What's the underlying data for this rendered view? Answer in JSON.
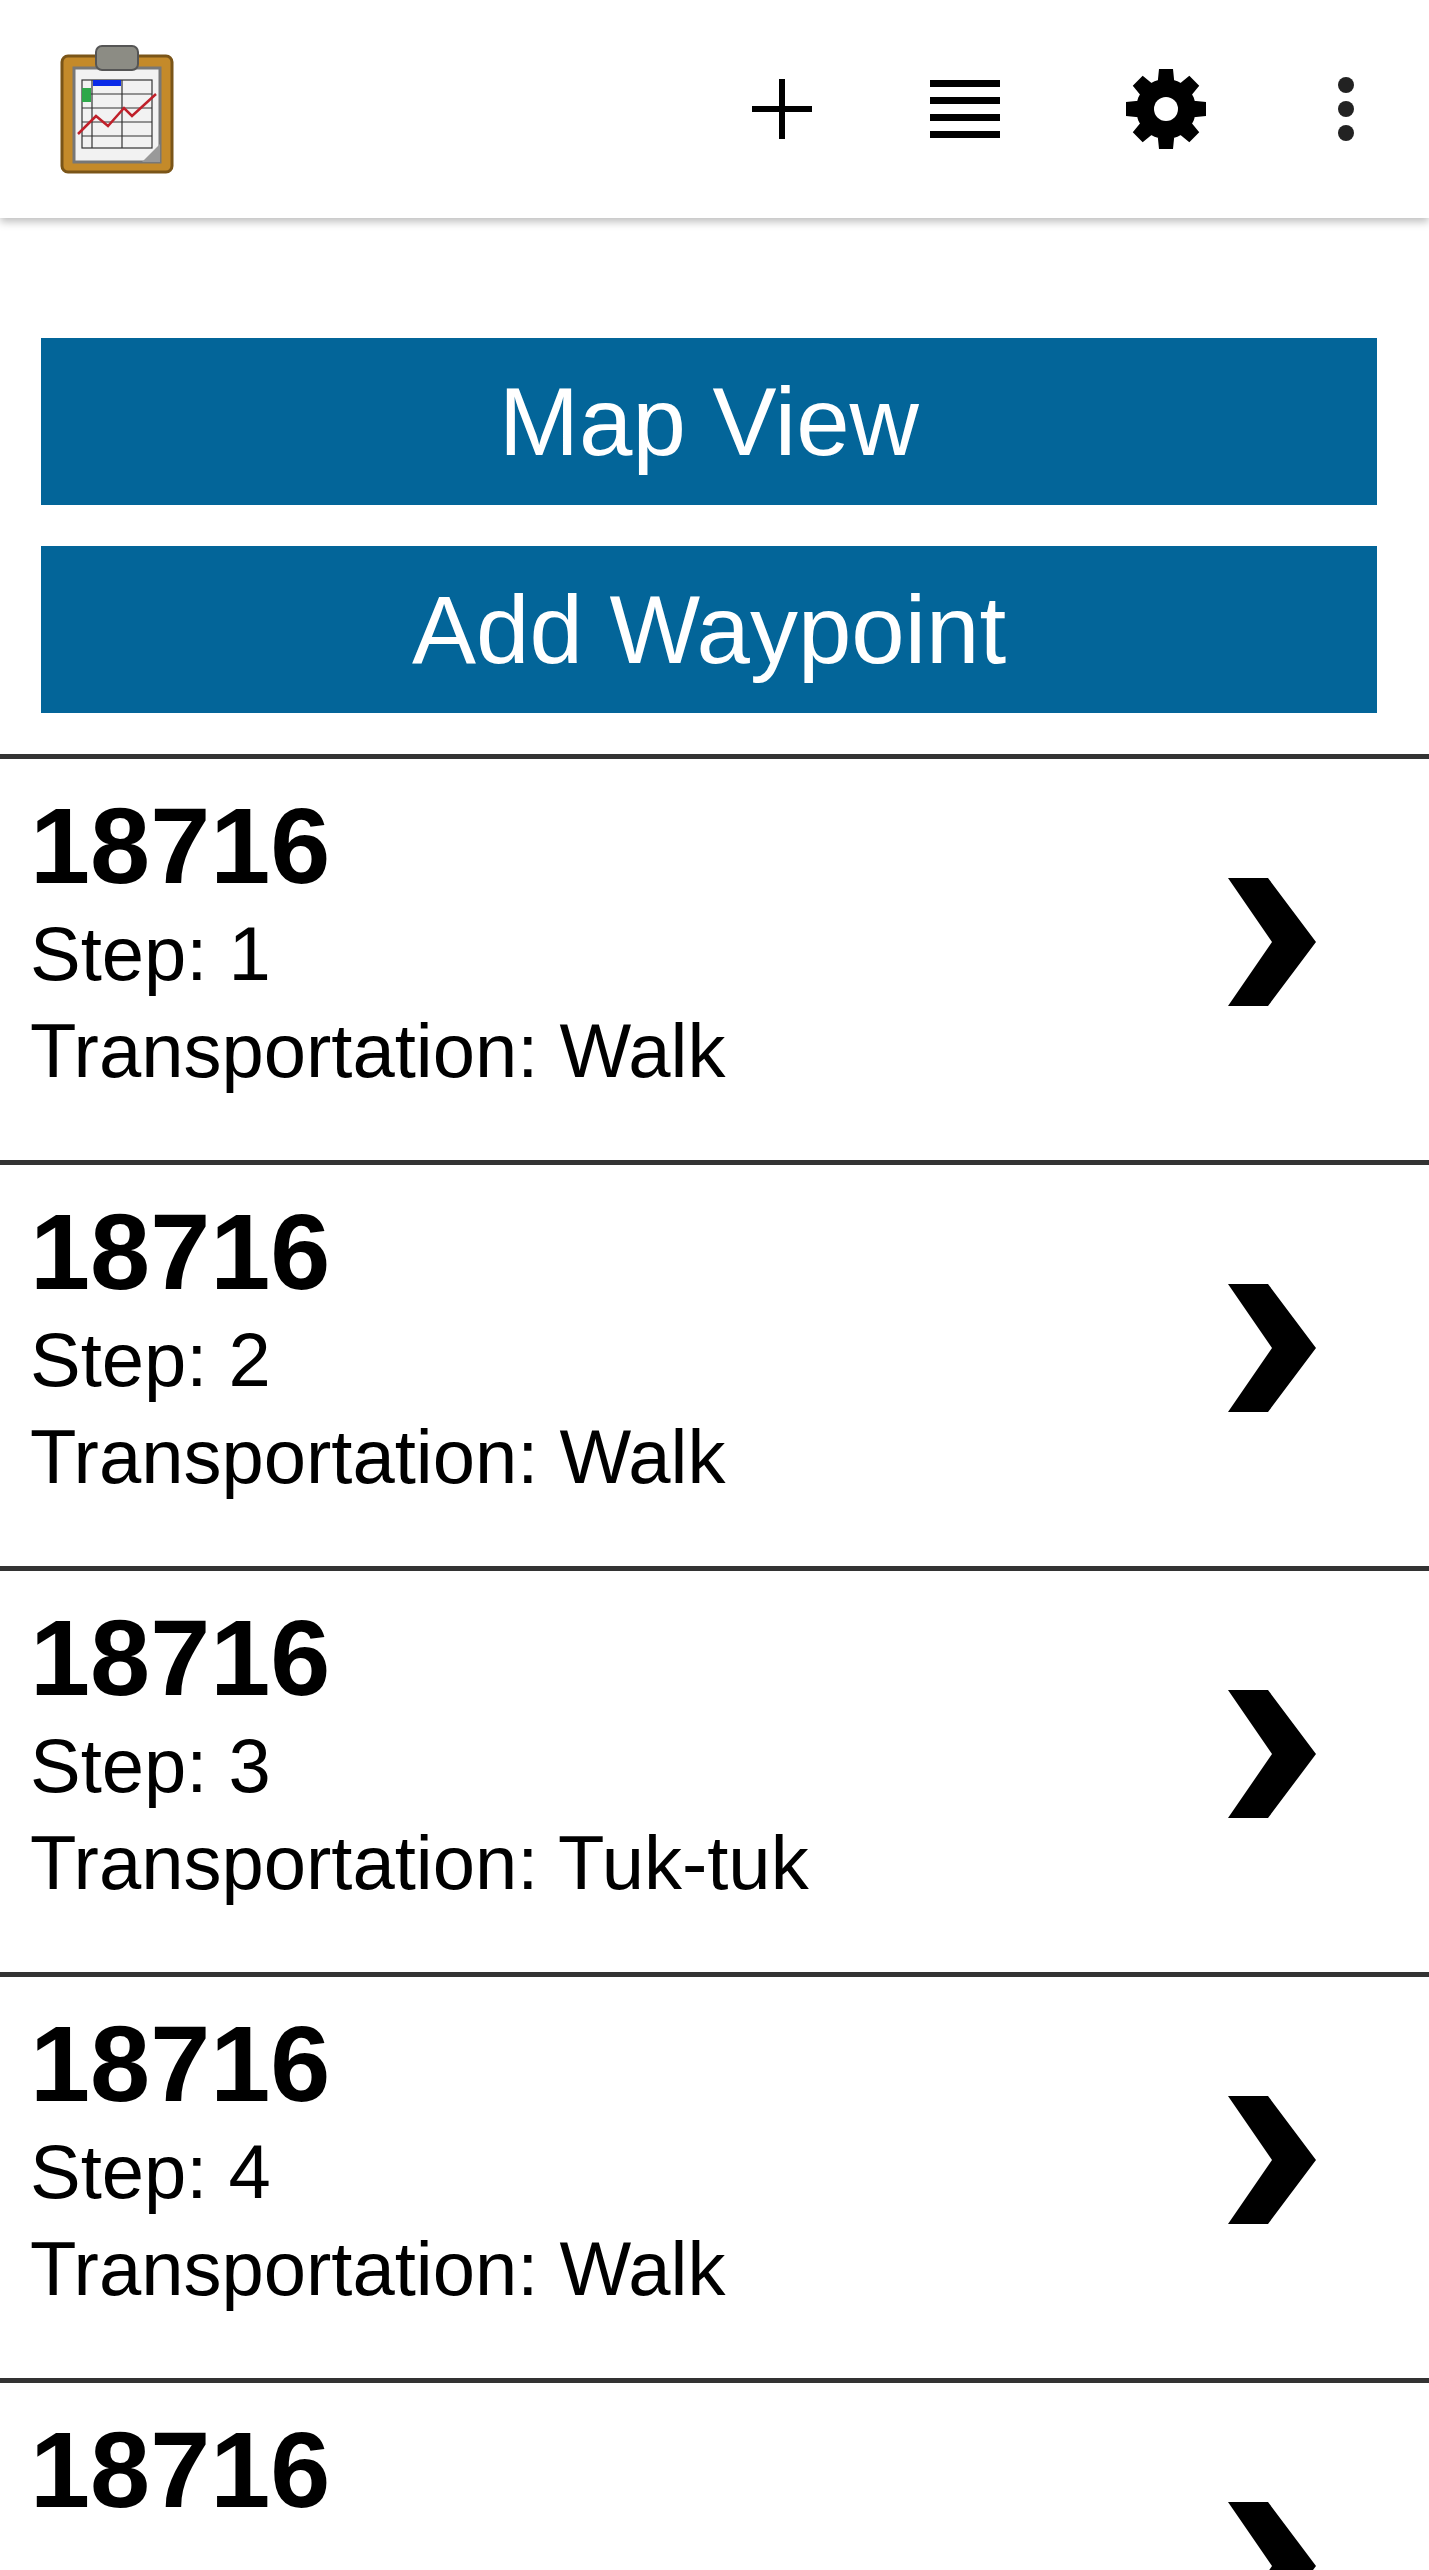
{
  "buttons": [
    {
      "label": "Map View"
    },
    {
      "label": "Add Waypoint"
    }
  ],
  "waypoints": [
    {
      "title": "18716",
      "step": "Step: 1",
      "transportation": "Transportation: Walk"
    },
    {
      "title": "18716",
      "step": "Step: 2",
      "transportation": "Transportation: Walk"
    },
    {
      "title": "18716",
      "step": "Step: 3",
      "transportation": "Transportation: Tuk-tuk"
    },
    {
      "title": "18716",
      "step": "Step: 4",
      "transportation": "Transportation: Walk"
    },
    {
      "title": "18716"
    }
  ]
}
